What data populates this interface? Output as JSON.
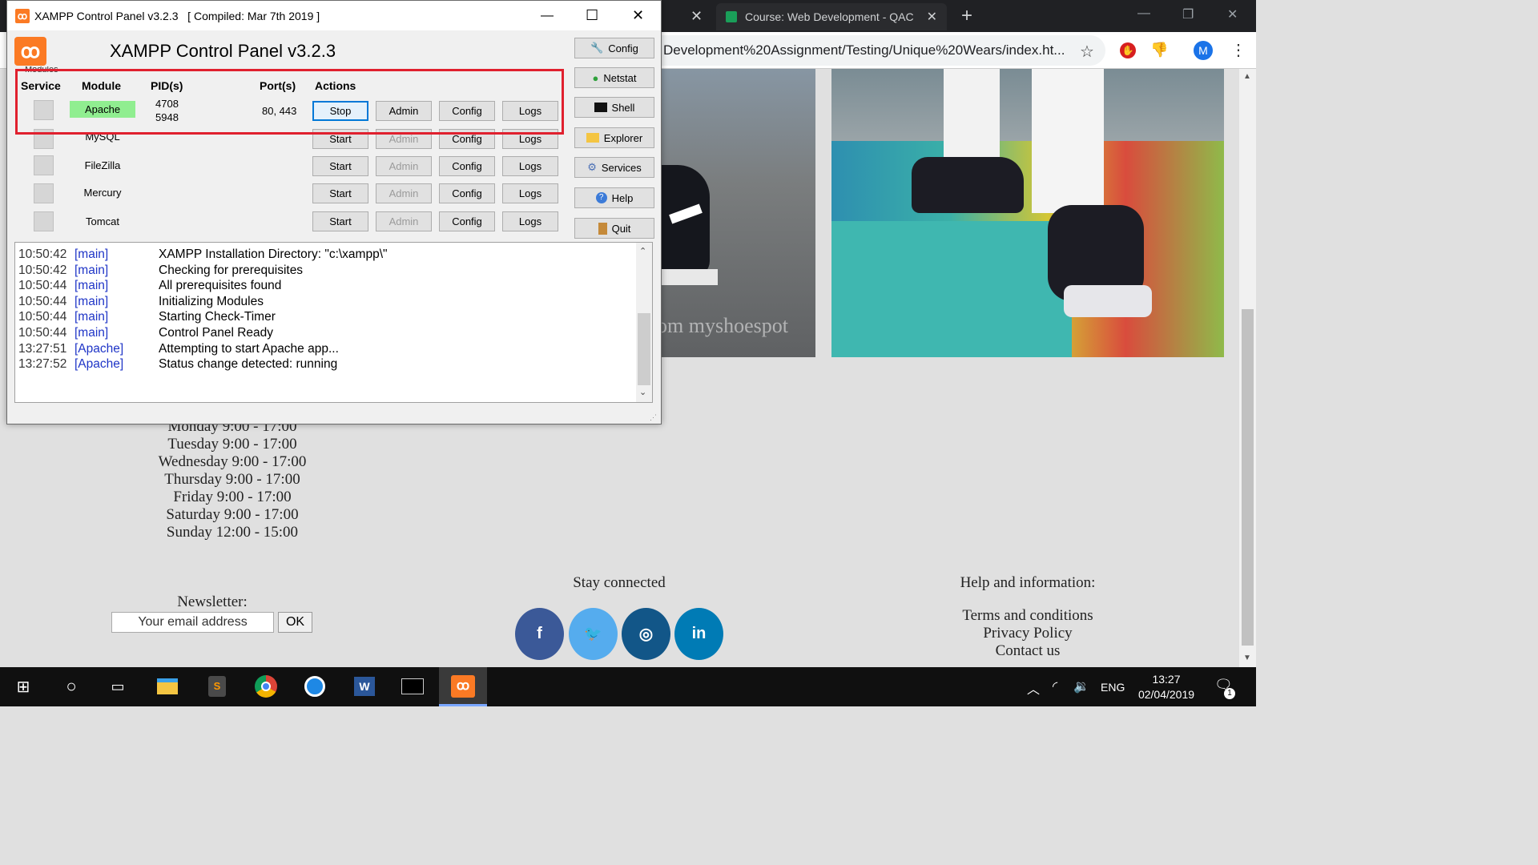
{
  "chrome": {
    "tab_course": "Course: Web Development - QAC",
    "new_tab_icon": "plus-icon",
    "address": "Development%20Assignment/Testing/Unique%20Wears/index.ht...",
    "profile_initial": "M"
  },
  "page": {
    "watermark": "om myshoespot",
    "hours": [
      "Monday 9:00 - 17:00",
      "Tuesday 9:00 - 17:00",
      "Wednesday 9:00 - 17:00",
      "Thursday 9:00 - 17:00",
      "Friday 9:00 - 17:00",
      "Saturday 9:00 - 17:00",
      "Sunday 12:00 - 15:00"
    ],
    "newsletter_label": "Newsletter:",
    "email_placeholder": "Your email address",
    "ok_label": "OK",
    "stay_connected": "Stay connected",
    "social": [
      {
        "name": "facebook-icon",
        "glyph": "f",
        "color": "#3b5998"
      },
      {
        "name": "twitter-icon",
        "glyph": "🐦",
        "color": "#55acee"
      },
      {
        "name": "instagram-icon",
        "glyph": "◎",
        "color": "#125688"
      },
      {
        "name": "linkedin-icon",
        "glyph": "in",
        "color": "#007bb5"
      }
    ],
    "help_title": "Help and information:",
    "help_links": [
      "Terms and conditions",
      "Privacy Policy",
      "Contact us"
    ]
  },
  "xampp": {
    "window_title": "XAMPP Control Panel v3.2.3   [ Compiled: Mar 7th 2019 ]",
    "heading": "XAMPP Control Panel v3.2.3",
    "modules_label": "Modules",
    "headers": {
      "service": "Service",
      "module": "Module",
      "pids": "PID(s)",
      "ports": "Port(s)",
      "actions": "Actions"
    },
    "modules": [
      {
        "name": "Apache",
        "pid1": "4708",
        "pid2": "5948",
        "ports": "80, 443",
        "action": "Stop",
        "running": true
      },
      {
        "name": "MySQL",
        "pid1": "",
        "pid2": "",
        "ports": "",
        "action": "Start",
        "running": false
      },
      {
        "name": "FileZilla",
        "pid1": "",
        "pid2": "",
        "ports": "",
        "action": "Start",
        "running": false
      },
      {
        "name": "Mercury",
        "pid1": "",
        "pid2": "",
        "ports": "",
        "action": "Start",
        "running": false
      },
      {
        "name": "Tomcat",
        "pid1": "",
        "pid2": "",
        "ports": "",
        "action": "Start",
        "running": false
      }
    ],
    "admin_label": "Admin",
    "config_label": "Config",
    "logs_label": "Logs",
    "side_buttons": [
      "Config",
      "Netstat",
      "Shell",
      "Explorer",
      "Services",
      "Help",
      "Quit"
    ],
    "log": [
      {
        "time": "10:50:42",
        "module": "[main]",
        "msg": "XAMPP Installation Directory: \"c:\\xampp\\\""
      },
      {
        "time": "10:50:42",
        "module": "[main]",
        "msg": "Checking for prerequisites"
      },
      {
        "time": "10:50:44",
        "module": "[main]",
        "msg": "All prerequisites found"
      },
      {
        "time": "10:50:44",
        "module": "[main]",
        "msg": "Initializing Modules"
      },
      {
        "time": "10:50:44",
        "module": "[main]",
        "msg": "Starting Check-Timer"
      },
      {
        "time": "10:50:44",
        "module": "[main]",
        "msg": "Control Panel Ready"
      },
      {
        "time": "13:27:51",
        "module": "[Apache]",
        "msg": "Attempting to start Apache app..."
      },
      {
        "time": "13:27:52",
        "module": "[Apache]",
        "msg": "Status change detected: running"
      }
    ]
  },
  "taskbar": {
    "lang": "ENG",
    "time": "13:27",
    "date": "02/04/2019",
    "notification_count": "1"
  },
  "colors": {
    "highlight_red": "#e0202e",
    "apache_running": "#90ee90",
    "log_module": "#1f35c7"
  }
}
